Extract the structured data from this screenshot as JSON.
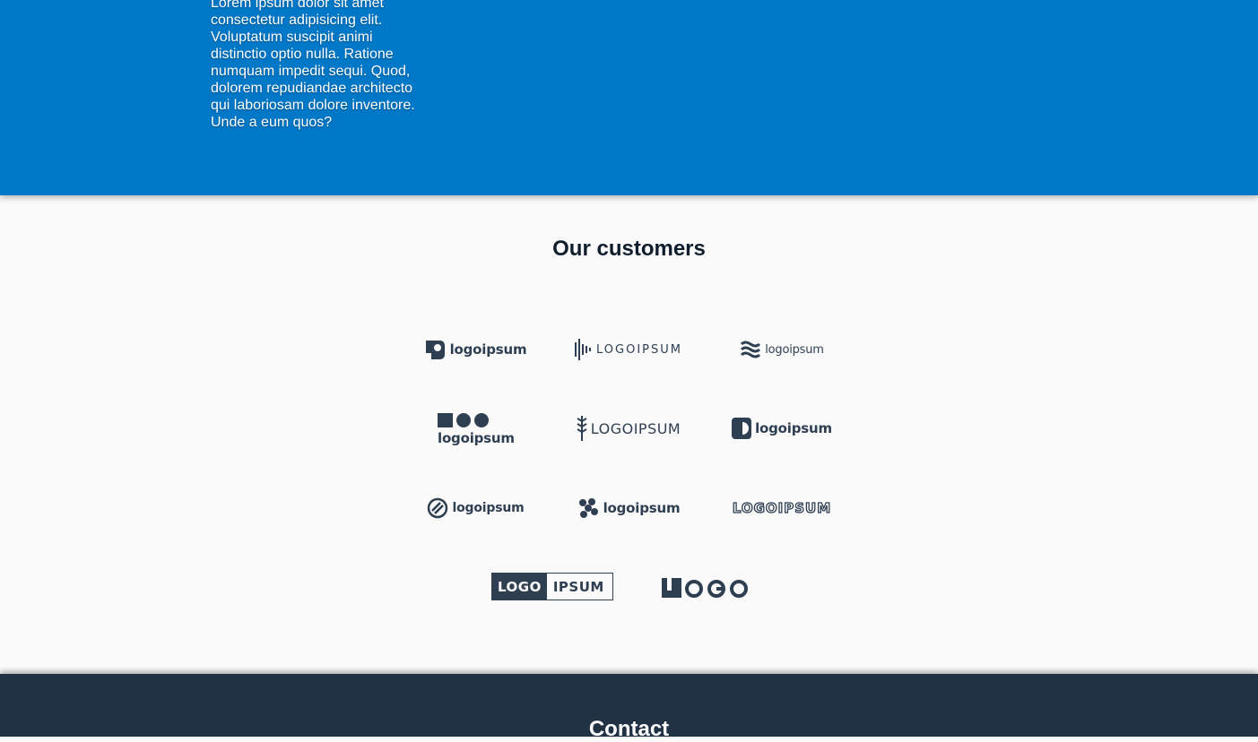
{
  "hero": {
    "body_text": "Lorem ipsum dolor sit amet consectetur adipisicing elit. Voluptatum suscipit animi distinctio optio nulla. Ratione numquam impedit sequi. Quod, dolorem repudiandae architecto qui laboriosam dolore inventore. Unde a eum quos?",
    "background_color": "#0078c8"
  },
  "customers": {
    "title": "Our customers",
    "logos": [
      {
        "icon": "square-loop-icon",
        "text": "logoipsum"
      },
      {
        "icon": "sound-bars-icon",
        "text": "LOGOIPSUM"
      },
      {
        "icon": "waves-icon",
        "text": "logoipsum"
      },
      {
        "icon": "square-circles-icon",
        "text": "logoipsum"
      },
      {
        "icon": "wheat-icon",
        "text": "LOGOIPSUM"
      },
      {
        "icon": "half-circle-icon",
        "text": "logoipsum"
      },
      {
        "icon": "slashed-circle-icon",
        "text": "logoipsum"
      },
      {
        "icon": "dots-cluster-icon",
        "text": "logoipsum"
      },
      {
        "icon": "outlined-wordmark-icon",
        "text": "LOGOIPSUM"
      },
      {
        "icon": "boxed-wordmark-icon",
        "text_left": "LOGO",
        "text_right": "IPSUM"
      },
      {
        "icon": "block-letters-icon",
        "text": "LOGO"
      }
    ],
    "logo_color": "#2f3f52"
  },
  "footer": {
    "contact_title": "Contact",
    "background_color": "#213244"
  }
}
